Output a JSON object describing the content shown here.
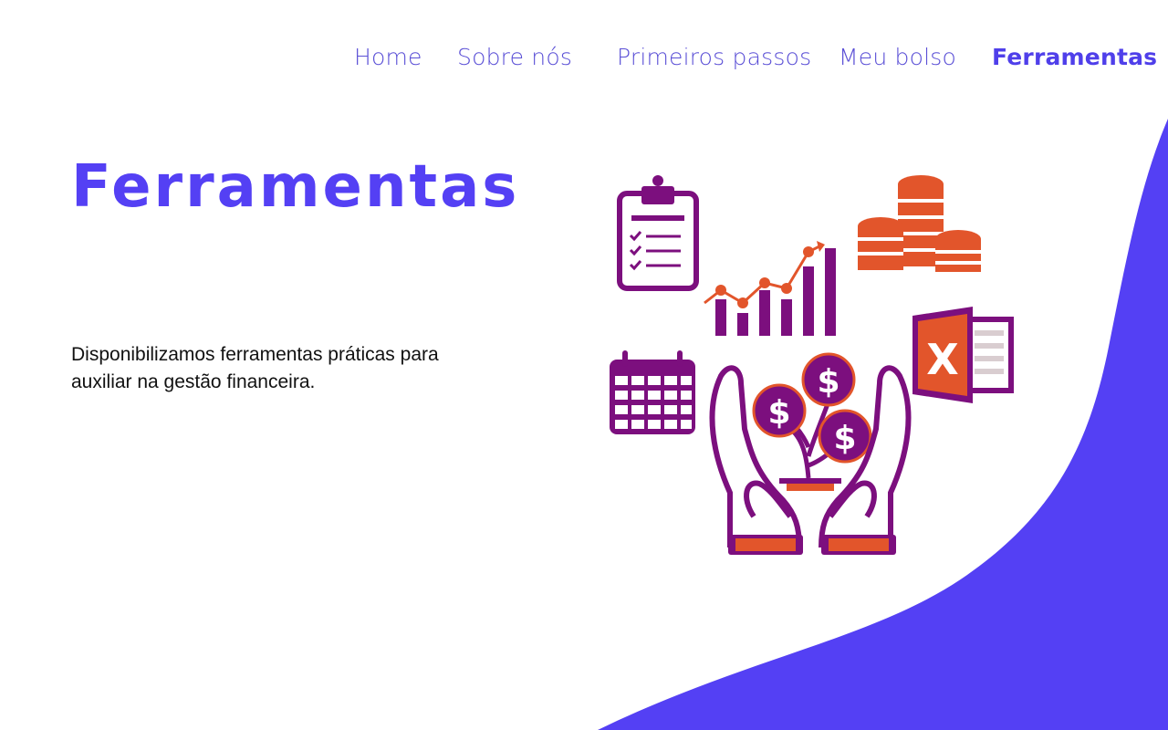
{
  "nav": {
    "items": [
      {
        "label": "Home"
      },
      {
        "label": "Sobre nós"
      },
      {
        "label": "Primeiros passos"
      },
      {
        "label": "Meu bolso"
      },
      {
        "label": "Ferramentas"
      }
    ],
    "active": "Ferramentas"
  },
  "hero": {
    "title": "Ferramentas",
    "description": "Disponibilizamos ferramentas práticas para auxiliar na gestão financeira."
  },
  "illustration": {
    "icons": [
      "clipboard-checklist-icon",
      "growth-chart-icon",
      "coin-stacks-icon",
      "calendar-icon",
      "hands-money-plant-icon",
      "spreadsheet-icon"
    ],
    "currency_symbol": "$",
    "spreadsheet_letter": "X"
  },
  "colors": {
    "accent": "#5440f4",
    "nav_text": "#5a4fd6",
    "purple": "#7c0f7e",
    "orange": "#e2552b",
    "text": "#111111",
    "background": "#ffffff"
  }
}
